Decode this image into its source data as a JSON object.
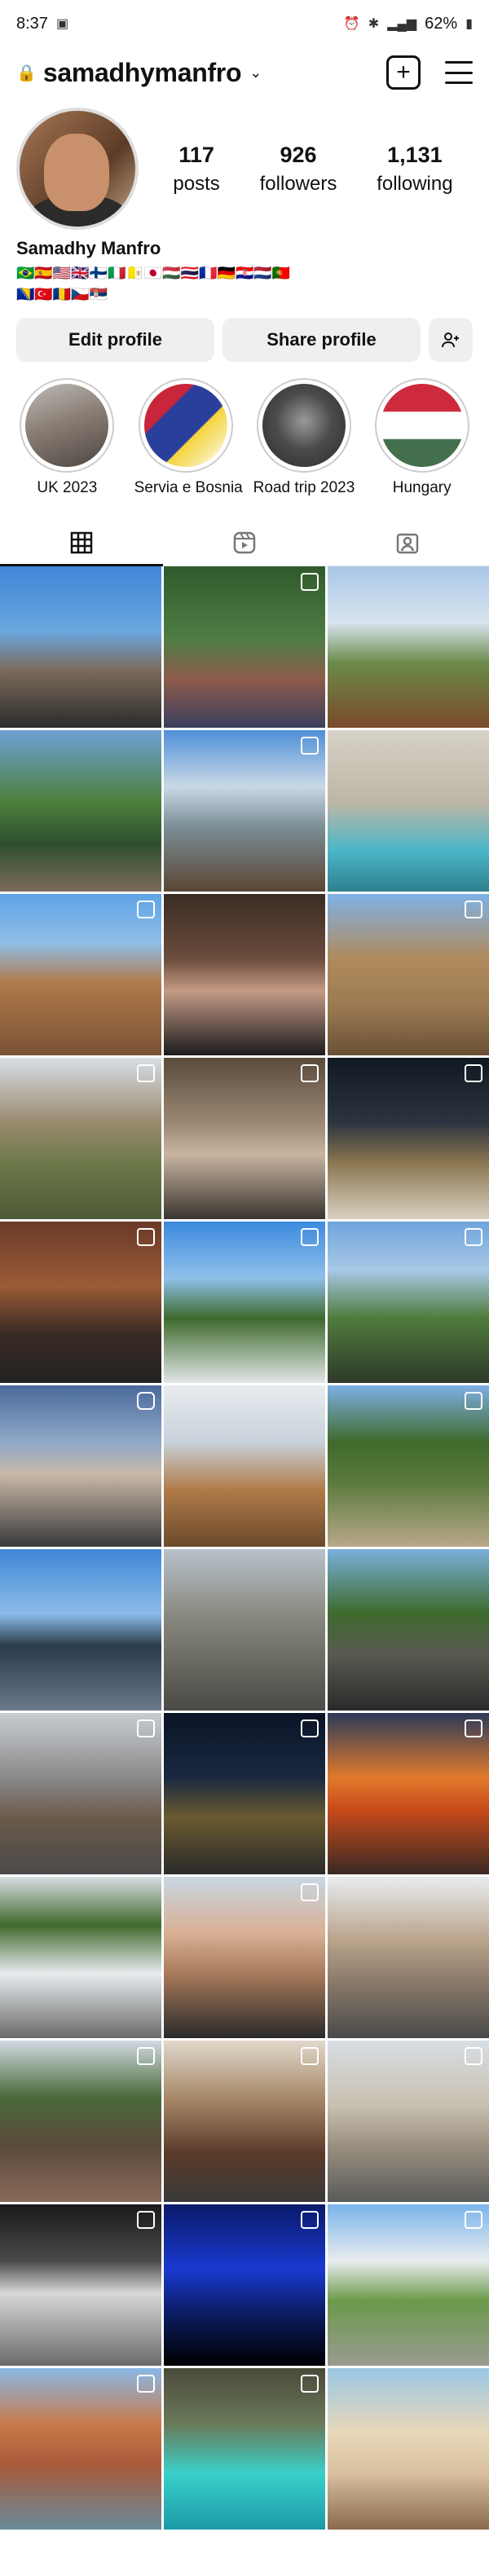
{
  "status": {
    "time": "8:37",
    "battery": "62%"
  },
  "profile": {
    "username": "samadhymanfro",
    "display_name": "Samadhy Manfro",
    "stats": [
      {
        "value": "117",
        "label": "posts"
      },
      {
        "value": "926",
        "label": "followers"
      },
      {
        "value": "1,131",
        "label": "following"
      }
    ],
    "flags_line1": "🇧🇷🇪🇸🇺🇸🇬🇧🇫🇮🇮🇹🇻🇦🇯🇵🇭🇺🇹🇭🇫🇷🇩🇪🇭🇷🇳🇱🇵🇹",
    "flags_line2": "🇧🇦🇹🇷🇷🇴🇨🇿🇷🇸"
  },
  "buttons": {
    "edit": "Edit profile",
    "share": "Share profile"
  },
  "highlights": [
    {
      "label": "UK 2023"
    },
    {
      "label": "Servia e Bosnia"
    },
    {
      "label": "Road trip 2023"
    },
    {
      "label": "Hungary"
    }
  ],
  "tabs": [
    {
      "icon": "grid-icon"
    },
    {
      "icon": "reels-icon"
    },
    {
      "icon": "tagged-icon"
    }
  ],
  "grid_icons": [
    "carousel-icon",
    "reel-icon"
  ]
}
